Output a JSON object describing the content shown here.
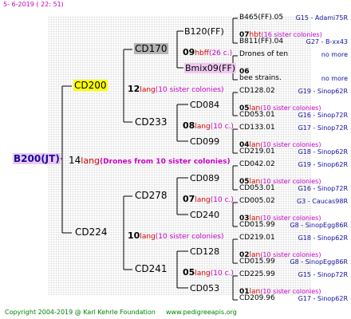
{
  "header": {
    "date": "5-  6-2019 ( 22: 51)"
  },
  "root": {
    "name": "B200(JT)",
    "number": "14",
    "lang": "lang",
    "note": "(Drones from 10 sister colonies)"
  },
  "gen1": [
    {
      "name": "CD200",
      "number": "12",
      "lang": "lang",
      "note": "(10 sister colonies)"
    },
    {
      "name": "CD224",
      "number": "10",
      "lang": "lang",
      "note": "(10 sister colonies)"
    }
  ],
  "gen2": [
    {
      "name": "CD170",
      "number": "09",
      "lang": "hbff",
      "note": "(26 c.)"
    },
    {
      "name": "CD233",
      "number": "08",
      "lang": "lang",
      "note": "(10 c.)"
    },
    {
      "name": "CD278",
      "number": "07",
      "lang": "lang",
      "note": "(10 c.)"
    },
    {
      "name": "CD241",
      "number": "05",
      "lang": "lang",
      "note": "(10 c.)"
    }
  ],
  "gen3": [
    {
      "name": "B120(FF)"
    },
    {
      "name": "Bmix09(FF)"
    },
    {
      "name": "CD084"
    },
    {
      "name": "CD099"
    },
    {
      "name": "CD089"
    },
    {
      "name": "CD240"
    },
    {
      "name": "CD128"
    },
    {
      "name": "CD053"
    }
  ],
  "gen4": [
    {
      "top": "B465(FF).05",
      "top_loc": "G15 - Adami75R",
      "num": "07",
      "lang": "hbt",
      "note": "(16 sister colonies)",
      "bottom": "B811(FF).04",
      "bottom_loc": "G27 - B-xx43"
    },
    {
      "top": "Drones of ten",
      "top_loc": "no more",
      "num": "06",
      "lang": "",
      "note": "",
      "bottom": "bee strains.",
      "bottom_loc": "no more"
    },
    {
      "top": "CD128.02",
      "top_loc": "G19 - Sinop62R",
      "num": "05",
      "lang": "lan",
      "note": "(10 sister colonies)",
      "bottom": "CD053.01",
      "bottom_loc": "G16 - Sinop72R"
    },
    {
      "top": "CD133.01",
      "top_loc": "G17 - Sinop72R",
      "num": "04",
      "lang": "lan",
      "note": "(10 sister colonies)",
      "bottom": "CD219.01",
      "bottom_loc": "G18 - Sinop62R"
    },
    {
      "top": "CD042.02",
      "top_loc": "G19 - Sinop62R",
      "num": "05",
      "lang": "lan",
      "note": "(10 sister colonies)",
      "bottom": "CD053.01",
      "bottom_loc": "G16 - Sinop72R"
    },
    {
      "top": "CD005.02",
      "top_loc": "G3 - Caucas98R",
      "num": "03",
      "lang": "lan",
      "note": "(10 sister colonies)",
      "bottom": "CD015.99",
      "bottom_loc": "G8 - SinopEgg86R"
    },
    {
      "top": "CD219.01",
      "top_loc": "G18 - Sinop62R",
      "num": "02",
      "lang": "lan",
      "note": "(10 sister colonies)",
      "bottom": "CD015.99",
      "bottom_loc": "G8 - SinopEgg86R"
    },
    {
      "top": "CD225.99",
      "top_loc": "G15 - Sinop72R",
      "num": "01",
      "lang": "lan",
      "note": "(10 sister colonies)",
      "bottom": "CD209.96",
      "bottom_loc": "G17 - Sinop62R"
    }
  ],
  "footer": {
    "copyright": "Copyright 2004-2019 @ Karl Kehrle Foundation",
    "website": "www.pedigreeapis.org"
  }
}
